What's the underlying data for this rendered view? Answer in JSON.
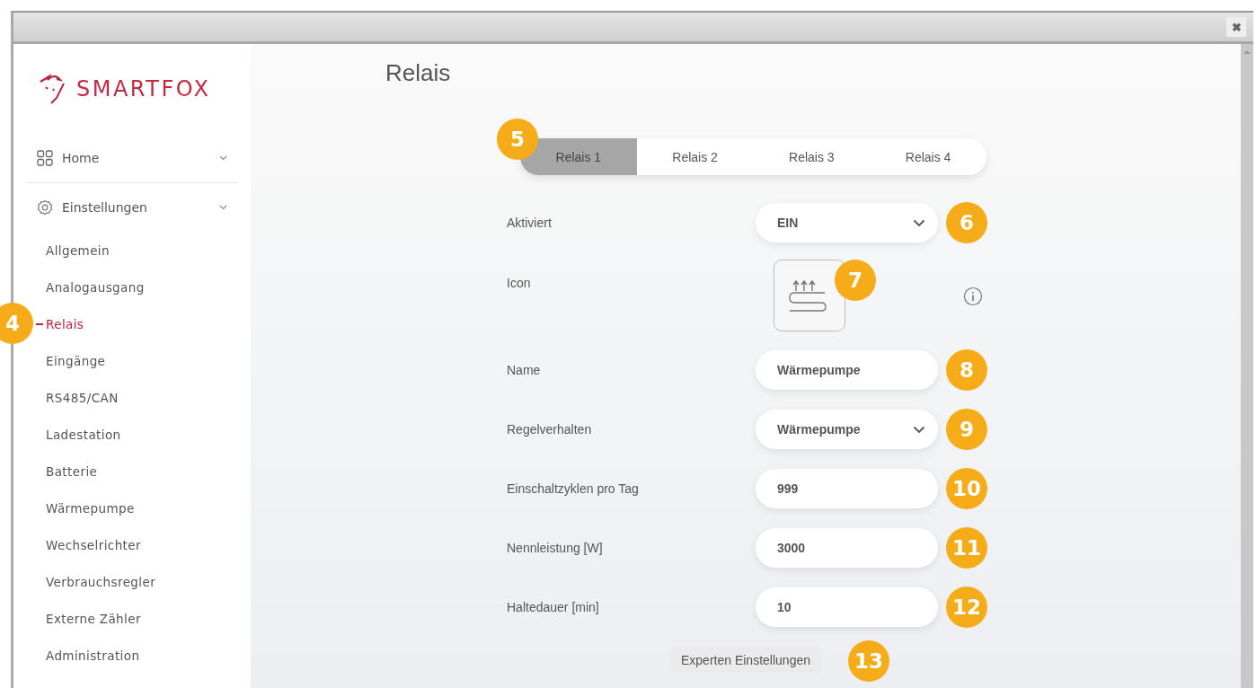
{
  "window": {
    "close": "✖"
  },
  "sidebar": {
    "logo": "SMARTFOX",
    "sections": [
      {
        "label": "Home",
        "kind": "grid"
      },
      {
        "label": "Einstellungen",
        "kind": "gear"
      }
    ],
    "items": [
      {
        "label": "Allgemein",
        "selected": false
      },
      {
        "label": "Analogausgang",
        "selected": false
      },
      {
        "label": "Relais",
        "selected": true,
        "callout": "4"
      },
      {
        "label": "Eingänge",
        "selected": false
      },
      {
        "label": "RS485/CAN",
        "selected": false
      },
      {
        "label": "Ladestation",
        "selected": false
      },
      {
        "label": "Batterie",
        "selected": false
      },
      {
        "label": "Wärmepumpe",
        "selected": false
      },
      {
        "label": "Wechselrichter",
        "selected": false
      },
      {
        "label": "Verbrauchsregler",
        "selected": false
      },
      {
        "label": "Externe Zähler",
        "selected": false
      },
      {
        "label": "Administration",
        "selected": false
      }
    ]
  },
  "page": {
    "title": "Relais",
    "tabs_callout": "5",
    "tabs": [
      {
        "label": "Relais 1",
        "selected": true
      },
      {
        "label": "Relais 2",
        "selected": false
      },
      {
        "label": "Relais 3",
        "selected": false
      },
      {
        "label": "Relais 4",
        "selected": false
      }
    ],
    "fields": [
      {
        "kind": "select",
        "label": "Aktiviert",
        "value": "EIN",
        "callout": "6"
      },
      {
        "kind": "icon",
        "label": "Icon",
        "callout": "7"
      },
      {
        "kind": "text",
        "label": "Name",
        "value": "Wärmepumpe",
        "callout": "8"
      },
      {
        "kind": "select",
        "label": "Regelverhalten",
        "value": "Wärmepumpe",
        "callout": "9"
      },
      {
        "kind": "text",
        "label": "Einschaltzyklen pro Tag",
        "value": "999",
        "callout": "10"
      },
      {
        "kind": "text",
        "label": "Nennleistung [W]",
        "value": "3000",
        "callout": "11"
      },
      {
        "kind": "text",
        "label": "Haltedauer [min]",
        "value": "10",
        "callout": "12"
      }
    ],
    "expert_button": {
      "label": "Experten Einstellungen",
      "callout": "13"
    }
  }
}
